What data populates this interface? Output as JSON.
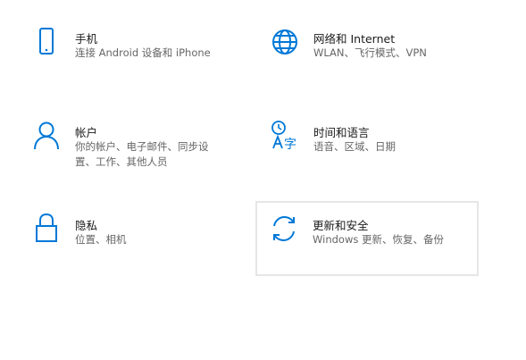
{
  "accent_color": "#0078d7",
  "tiles": [
    {
      "title": "手机",
      "desc": "连接 Android 设备和 iPhone",
      "icon": "phone-icon"
    },
    {
      "title": "网络和 Internet",
      "desc": "WLAN、飞行模式、VPN",
      "icon": "globe-icon"
    },
    {
      "title": "帐户",
      "desc": "你的帐户、电子邮件、同步设置、工作、其他人员",
      "icon": "person-icon"
    },
    {
      "title": "时间和语言",
      "desc": "语音、区域、日期",
      "icon": "time-language-icon"
    },
    {
      "title": "隐私",
      "desc": "位置、相机",
      "icon": "lock-icon"
    },
    {
      "title": "更新和安全",
      "desc": "Windows 更新、恢复、备份",
      "icon": "sync-icon"
    }
  ]
}
